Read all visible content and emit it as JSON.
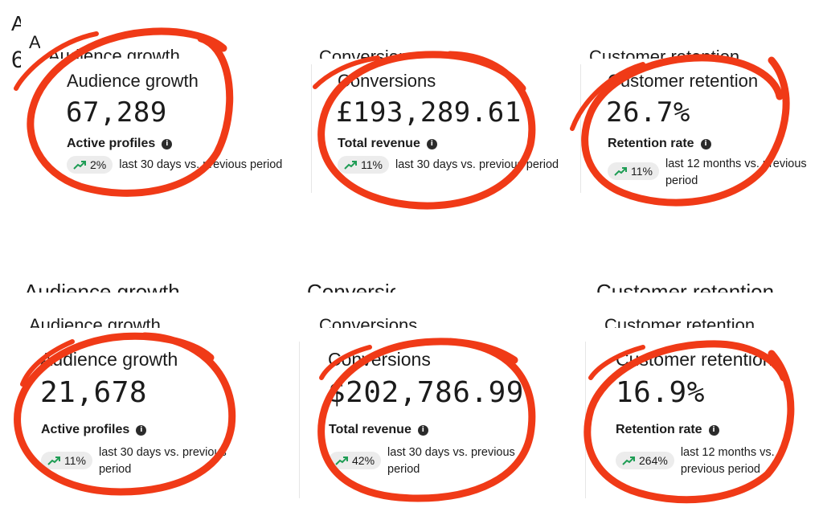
{
  "top_row": [
    {
      "title": "Audience growth",
      "value": "67,289",
      "label": "Active profiles",
      "change": "2%",
      "period": "last 30 days vs. previous period"
    },
    {
      "title": "Conversions",
      "value": "£193,289.61",
      "label": "Total revenue",
      "change": "11%",
      "period": "last 30 days vs. previous period"
    },
    {
      "title": "Customer retention",
      "value": "26.7%",
      "label": "Retention rate",
      "change": "11%",
      "period_line1": "last 12 months vs. previous",
      "period_line2": "period"
    }
  ],
  "bottom_row": [
    {
      "title": "Audience growth",
      "value": "21,678",
      "label": "Active profiles",
      "change": "11%",
      "period_line1": "last 30 days vs. previous",
      "period_line2": "period"
    },
    {
      "title": "Conversions",
      "value": "$202,786.99",
      "label": "Total revenue",
      "change": "42%",
      "period_line1": "last 30 days vs. previous",
      "period_line2": "period"
    },
    {
      "title": "Customer retention",
      "value": "16.9%",
      "label": "Retention rate",
      "change": "264%",
      "period_line1": "last 12 months vs.",
      "period_line2": "previous period"
    }
  ],
  "ghost_titles": {
    "audience": "Audience growth",
    "conversions": "Conversions",
    "retention": "Customer retention"
  },
  "icons": {
    "trend": "trend-up-icon",
    "info": "info-icon",
    "annotation": "red-circle-annotation"
  },
  "colors": {
    "annotation": "#f03a17",
    "trend": "#1f9d55",
    "pill_bg": "#ececec"
  }
}
